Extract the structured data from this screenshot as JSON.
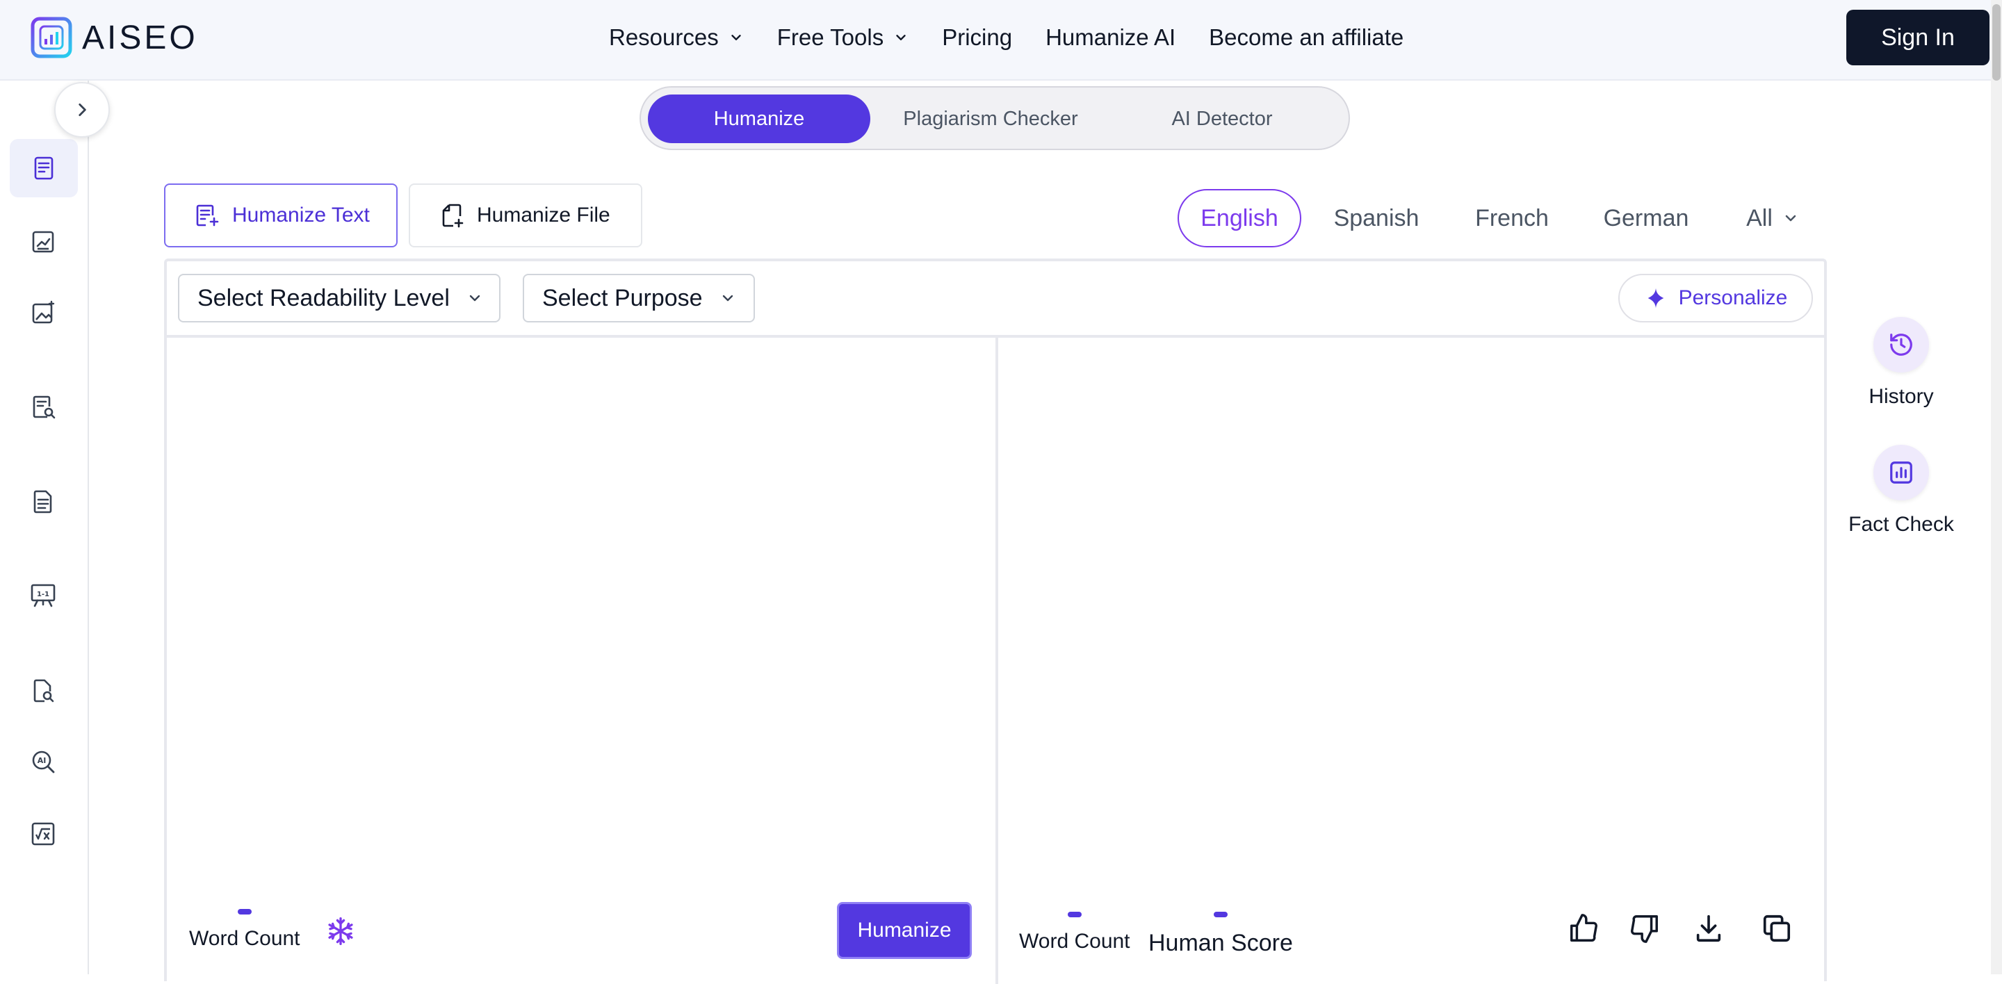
{
  "brand": {
    "name": "AISEO"
  },
  "nav": {
    "items": [
      {
        "label": "Resources",
        "dropdown": true
      },
      {
        "label": "Free Tools",
        "dropdown": true
      },
      {
        "label": "Pricing",
        "dropdown": false
      },
      {
        "label": "Humanize AI",
        "dropdown": false
      },
      {
        "label": "Become an affiliate",
        "dropdown": false
      }
    ],
    "signin_label": "Sign In"
  },
  "mode_tabs": {
    "humanize": "Humanize",
    "plagiarism": "Plagiarism Checker",
    "detector": "AI Detector",
    "active": "Humanize"
  },
  "tool_tabs": {
    "humanize_text": "Humanize Text",
    "humanize_file": "Humanize File",
    "active": "Humanize Text"
  },
  "languages": {
    "english": "English",
    "spanish": "Spanish",
    "french": "French",
    "german": "German",
    "all": "All",
    "active": "English"
  },
  "toolbar": {
    "readability": "Select Readability Level",
    "purpose": "Select Purpose",
    "personalize": "Personalize"
  },
  "editor": {
    "input_word_count_label": "Word Count",
    "humanize_button": "Humanize",
    "output_word_count_label": "Word Count",
    "human_score_label": "Human Score"
  },
  "right_rail": {
    "history": "History",
    "fact_check": "Fact Check"
  },
  "sidebar_icons": [
    "document-edit-icon",
    "chart-document-icon",
    "image-sparkle-icon",
    "document-search-icon",
    "document-text-icon",
    "presentation-board-icon",
    "file-search-icon",
    "ai-search-icon",
    "math-formula-icon"
  ],
  "colors": {
    "accent": "#5338e0",
    "accent_language": "#7c3aed",
    "signin_bg": "#0f172a",
    "topbar_bg": "#f5f7fc"
  }
}
